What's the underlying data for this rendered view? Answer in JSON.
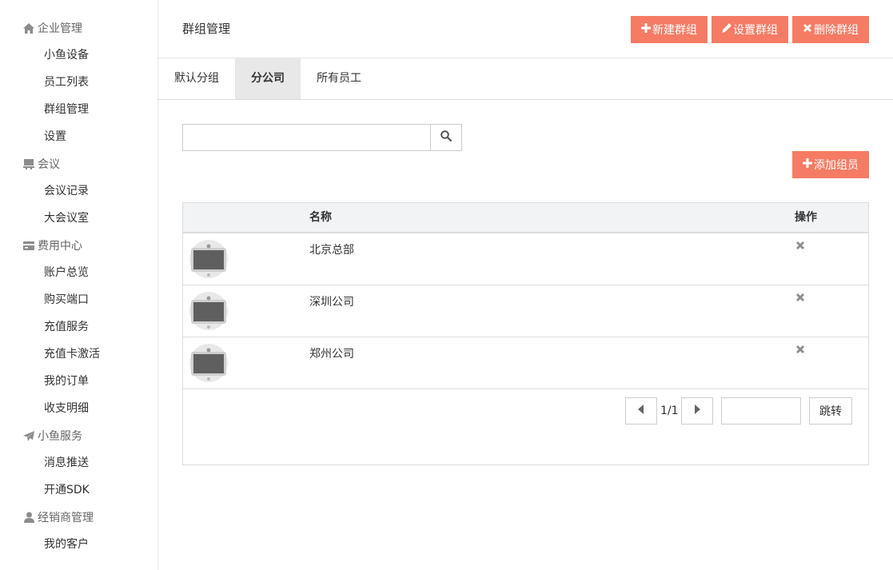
{
  "sidebar": {
    "sections": [
      {
        "label": "企业管理",
        "icon": "home-icon",
        "items": [
          "小鱼设备",
          "员工列表",
          "群组管理",
          "设置"
        ]
      },
      {
        "label": "会议",
        "icon": "meeting-icon",
        "items": [
          "会议记录",
          "大会议室"
        ]
      },
      {
        "label": "费用中心",
        "icon": "card-icon",
        "items": [
          "账户总览",
          "购买端口",
          "充值服务",
          "充值卡激活",
          "我的订单",
          "收支明细"
        ]
      },
      {
        "label": "小鱼服务",
        "icon": "send-icon",
        "items": [
          "消息推送",
          "开通SDK"
        ]
      },
      {
        "label": "经销商管理",
        "icon": "user-icon",
        "items": [
          "我的客户"
        ]
      }
    ]
  },
  "header": {
    "title": "群组管理",
    "new_group": "新建群组",
    "set_group": "设置群组",
    "delete_group": "删除群组"
  },
  "tabs": [
    "默认分组",
    "分公司",
    "所有员工"
  ],
  "active_tab": 1,
  "search": {
    "value": "",
    "placeholder": ""
  },
  "add_member": "添加组员",
  "table": {
    "headers": {
      "name": "名称",
      "action": "操作"
    },
    "rows": [
      {
        "name": "北京总部"
      },
      {
        "name": "深圳公司"
      },
      {
        "name": "郑州公司"
      }
    ]
  },
  "pager": {
    "page": "1/1",
    "jump_value": "",
    "jump_label": "跳转"
  },
  "colors": {
    "accent": "#f57b64",
    "icon_gray": "#8c8c8c",
    "header_bg": "#f2f3f5"
  }
}
